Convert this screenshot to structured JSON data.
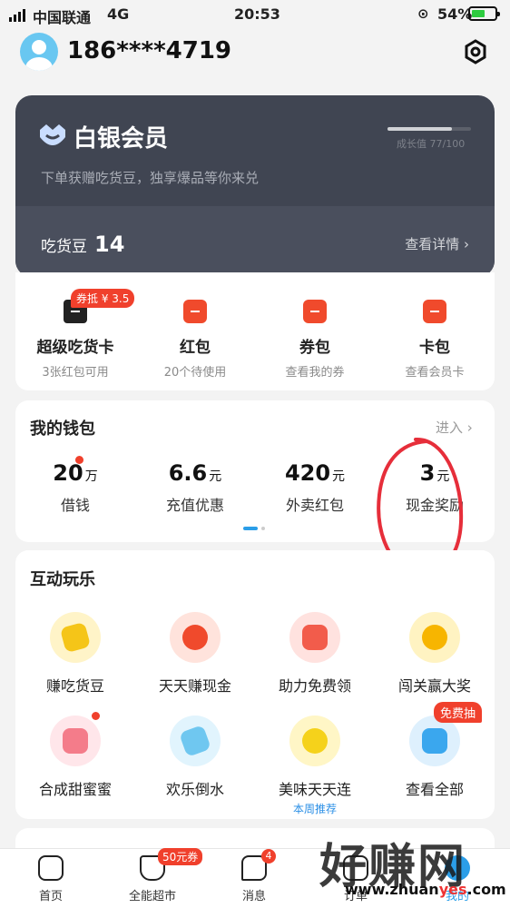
{
  "status_bar": {
    "carrier": "中国联通",
    "network": "4G",
    "time": "20:53",
    "battery": "54%",
    "battery_level": 0.54
  },
  "header": {
    "phone": "186****4719",
    "avatar_icon": "user-avatar-icon",
    "settings_icon": "gear-icon"
  },
  "vip": {
    "title": "白银会员",
    "subtitle": "下单获赠吃货豆，独享爆品等你来兑",
    "growth": "成长值 77/100",
    "growth_progress": 0.77,
    "beans_label": "吃货豆",
    "beans_value": "14",
    "details": "查看详情"
  },
  "quick": {
    "badge": "券抵 ¥ 3.5",
    "items": [
      {
        "label": "超级吃货卡",
        "sub": "3张红包可用"
      },
      {
        "label": "红包",
        "sub": "20个待使用"
      },
      {
        "label": "券包",
        "sub": "查看我的券"
      },
      {
        "label": "卡包",
        "sub": "查看会员卡"
      }
    ]
  },
  "wallet": {
    "title": "我的钱包",
    "enter": "进入",
    "items": [
      {
        "value": "20",
        "unit": "万",
        "label": "借钱"
      },
      {
        "value": "6.6",
        "unit": "元",
        "label": "充值优惠"
      },
      {
        "value": "420",
        "unit": "元",
        "label": "外卖红包"
      },
      {
        "value": "3",
        "unit": "元",
        "label": "现金奖励"
      }
    ]
  },
  "games": {
    "title": "互动玩乐",
    "free_badge": "免费抽",
    "items": [
      {
        "label": "赚吃货豆",
        "icon": "bean-icon",
        "color": "#f5c518"
      },
      {
        "label": "天天赚现金",
        "icon": "money-bag-icon",
        "color": "#f04a2c"
      },
      {
        "label": "助力免费领",
        "icon": "coupon-percent-icon",
        "color": "#f25c4b"
      },
      {
        "label": "闯关赢大奖",
        "icon": "magnifier-icon",
        "color": "#f7b500"
      },
      {
        "label": "合成甜蜜蜜",
        "icon": "cake-icon",
        "color": "#f47c8a"
      },
      {
        "label": "欢乐倒水",
        "icon": "cup-icon",
        "color": "#6fc7f0"
      },
      {
        "label": "美味天天连",
        "sub": "本周推荐",
        "icon": "lemon-icon",
        "color": "#f5d21b"
      },
      {
        "label": "查看全部",
        "icon": "cube-icon",
        "color": "#3aa7ee"
      }
    ]
  },
  "tabbar": {
    "cart_badge": "50元券",
    "msg_badge": "4",
    "items": [
      {
        "label": "首页"
      },
      {
        "label": "全能超市"
      },
      {
        "label": "消息"
      },
      {
        "label": "订单"
      },
      {
        "label": "我的"
      }
    ]
  },
  "watermark": {
    "main": "好赚网",
    "sub_pre": "www.zhuan",
    "sub_red": "yes",
    "sub_post": ".com"
  }
}
